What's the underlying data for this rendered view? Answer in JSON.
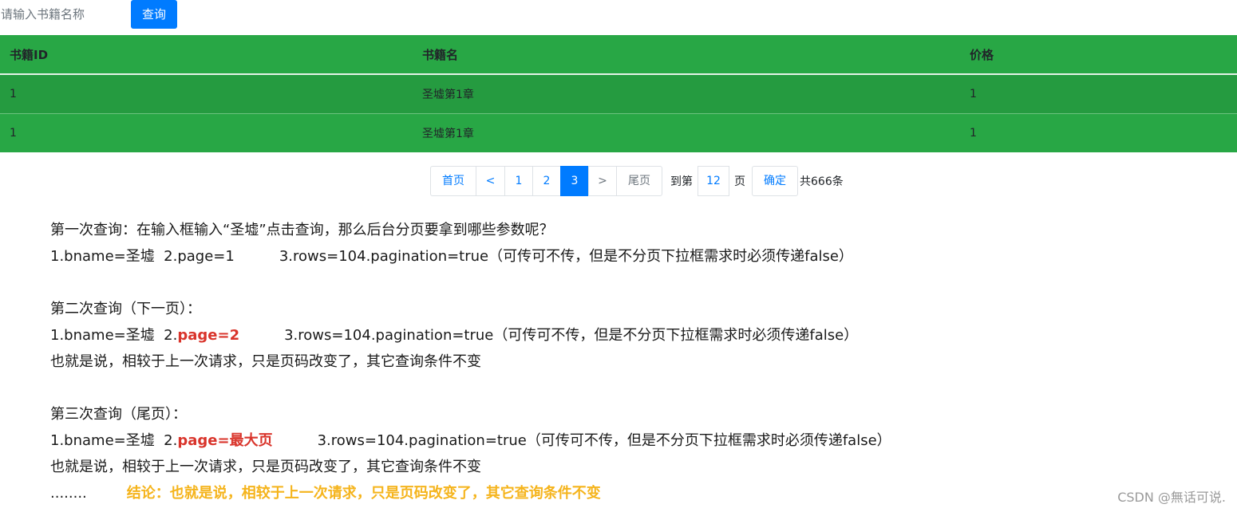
{
  "search": {
    "placeholder": "请输入书籍名称",
    "button_label": "查询"
  },
  "table": {
    "headers": [
      "书籍ID",
      "书籍名",
      "价格"
    ],
    "rows": [
      [
        "1",
        "圣墟第1章",
        "1"
      ],
      [
        "1",
        "圣墟第1章",
        "1"
      ]
    ]
  },
  "pagination": {
    "first": "首页",
    "prev": "<",
    "pages": [
      "1",
      "2",
      "3"
    ],
    "active_page": "3",
    "next": ">",
    "last": "尾页",
    "goto_prefix": "到第",
    "goto_value": "12",
    "goto_suffix": "页",
    "confirm": "确定",
    "total": "共666条"
  },
  "notes": {
    "q1_title": "第一次查询：在输入框输入“圣墟”点击查询，那么后台分页要拿到哪些参数呢？",
    "q1_params_a": "1.bname=圣墟  2.page=1",
    "q1_params_b": "3.rows=104.pagination=true（可传可不传，但是不分页下拉框需求时必须传递false）",
    "q2_title": "第二次查询（下一页）：",
    "q2_params_a": "1.bname=圣墟  2.",
    "q2_params_red": "page=2",
    "q2_params_b": "3.rows=104.pagination=true（可传可不传，但是不分页下拉框需求时必须传递false）",
    "q2_explain": "也就是说，相较于上一次请求，只是页码改变了，其它查询条件不变",
    "q3_title": "第三次查询（尾页）：",
    "q3_params_a": "1.bname=圣墟  2.",
    "q3_params_red": "page=最大页",
    "q3_params_b": "3.rows=104.pagination=true（可传可不传，但是不分页下拉框需求时必须传递false）",
    "q3_explain": "也就是说，相较于上一次请求，只是页码改变了，其它查询条件不变",
    "ellipsis": "........",
    "conclusion": "结论：也就是说，相较于上一次请求，只是页码改变了，其它查询条件不变"
  },
  "watermark": "CSDN @無话可说.",
  "colors": {
    "primary": "#007bff",
    "table_green": "#28a745",
    "emphasis_red": "#d9342b",
    "conclusion_yellow": "#f5b41c"
  }
}
